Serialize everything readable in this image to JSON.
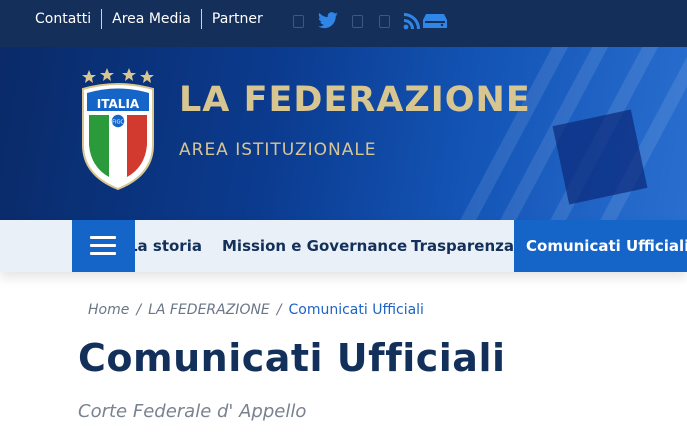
{
  "topbar": {
    "links": [
      "Contatti",
      "Area Media",
      "Partner"
    ],
    "social": [
      "facebook-icon",
      "twitter-icon",
      "instagram-icon",
      "youtube-icon",
      "rss-icon",
      "tv-icon"
    ]
  },
  "hero": {
    "title": "LA FEDERAZIONE",
    "subtitle": "AREA ISTITUZIONALE",
    "crest_text": "ITALIA",
    "crest_small": "FIGC"
  },
  "nav": {
    "items": [
      "La storia",
      "Mission e Governance",
      "Trasparenza",
      "Comunicati Ufficiali"
    ],
    "active": "Comunicati Ufficiali"
  },
  "breadcrumb": {
    "home": "Home",
    "section": "LA FEDERAZIONE",
    "current": "Comunicati Ufficiali"
  },
  "page": {
    "title": "Comunicati Ufficiali",
    "subtitle": "Corte Federale d' Appello"
  },
  "colors": {
    "topbar": "#14305a",
    "accent": "#1565c9",
    "gold": "#d8c690",
    "navy_text": "#12305a"
  }
}
